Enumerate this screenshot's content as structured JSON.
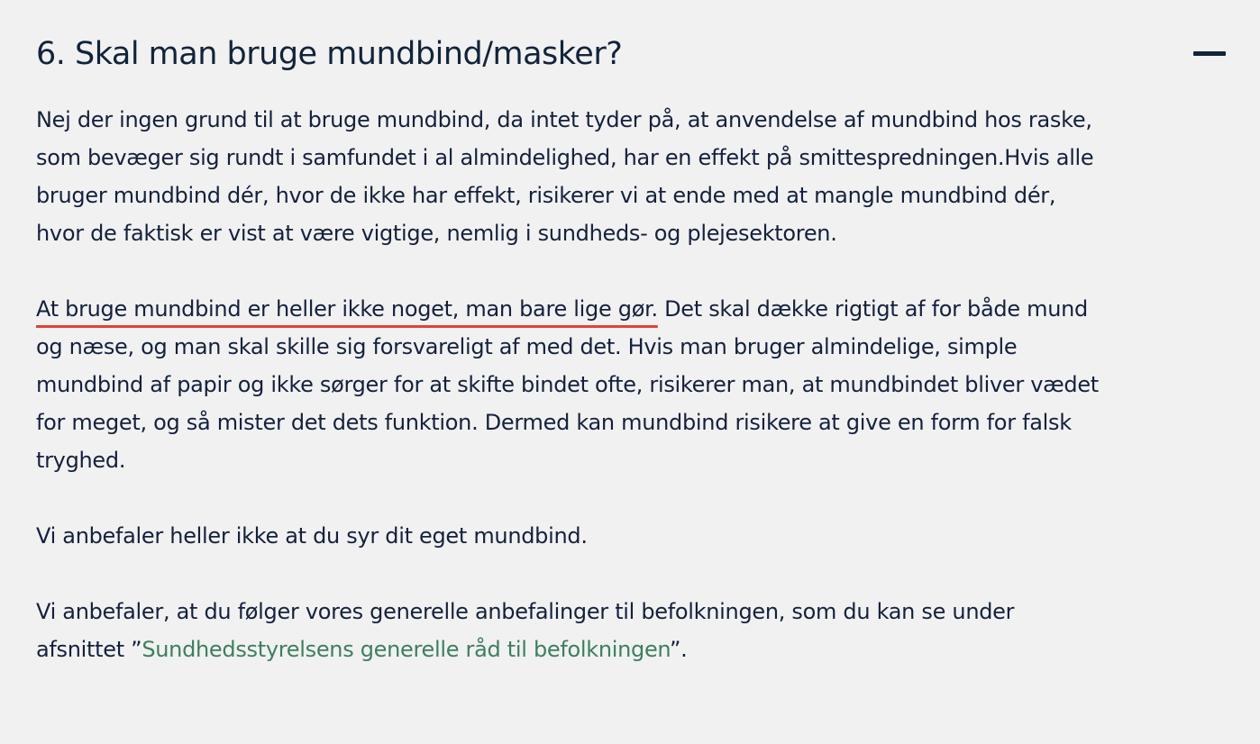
{
  "accordion": {
    "title": "6. Skal man bruge mundbind/masker?",
    "toggle_icon": "minus-icon",
    "paragraphs": {
      "p1": "Nej der ingen grund til at bruge mundbind, da intet tyder på, at anvendelse af mundbind hos raske, som bevæger sig rundt i samfundet i al almindelighed, har en effekt på smittespredningen.Hvis alle bruger mundbind dér, hvor de ikke har effekt, risikerer vi at ende med at mangle mundbind dér, hvor de faktisk er vist at være vigtige, nemlig i sundheds- og plejesektoren.",
      "p2_underlined": "At bruge mundbind er heller ikke noget, man bare lige gør.",
      "p2_rest": " Det skal dække rigtigt af for både mund og næse, og man skal skille sig forsvareligt af med det. Hvis man bruger almindelige, simple mundbind af papir og ikke sørger for at skifte bindet ofte, risikerer man, at mundbindet bliver vædet for meget, og så mister det dets funktion. Dermed kan mundbind risikere at give en form for falsk tryghed.",
      "p3": "Vi anbefaler heller ikke at du syr dit eget mundbind.",
      "p4_before": "Vi anbefaler, at du følger vores generelle anbefalinger til befolkningen, som du kan se under afsnittet ”",
      "p4_link": "Sundhedsstyrelsens generelle råd til befolkningen",
      "p4_after": "”."
    }
  },
  "colors": {
    "background": "#f1f1f1",
    "text": "#14213d",
    "link": "#3d7f5e",
    "underline_accent": "#e0433a"
  }
}
